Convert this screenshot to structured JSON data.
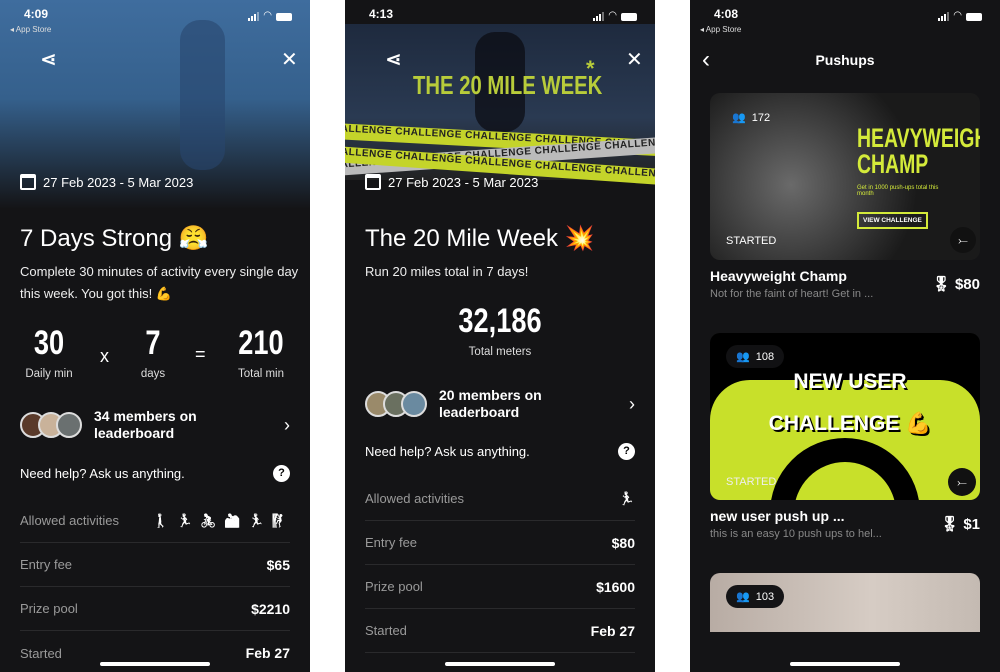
{
  "screens": [
    {
      "status_time": "4:09",
      "back_app": "◂ App Store",
      "date_range": "27 Feb 2023 - 5 Mar 2023",
      "title": "7 Days Strong 😤",
      "description": "Complete 30 minutes of activity every single day this week. You got this! 💪",
      "stats": [
        {
          "value": "30",
          "label": "Daily min"
        },
        {
          "op": "x"
        },
        {
          "value": "7",
          "label": "days"
        },
        {
          "op": "="
        },
        {
          "value": "210",
          "label": "Total min"
        }
      ],
      "leaderboard": "34 members on leaderboard",
      "help": "Need help? Ask us anything.",
      "activities_label": "Allowed activities",
      "activities_icons": [
        "walk",
        "run",
        "cycle",
        "mountain-bike",
        "treadmill",
        "hiking"
      ],
      "activities_glyphs": "🚶 🏃 🚴 🚵 🏃 🧗",
      "rows": [
        {
          "k": "Entry fee",
          "v": "$65"
        },
        {
          "k": "Prize pool",
          "v": "$2210"
        },
        {
          "k": "Started",
          "v": "Feb 27"
        }
      ]
    },
    {
      "status_time": "4:13",
      "hero_title": "THE 20 MILE WEEK",
      "hero_star": "*",
      "tape_text": "CHALLENGE  CHALLENGE  CHALLENGE  CHALLENGE  CHALLENGE  CHALLENGE",
      "date_range": "27 Feb 2023 - 5 Mar 2023",
      "title": "The 20 Mile Week 💥",
      "description": "Run 20 miles total in 7 days!",
      "total_value": "32,186",
      "total_label": "Total meters",
      "leaderboard": "20 members on leaderboard",
      "help": "Need help? Ask us anything.",
      "activities_label": "Allowed activities",
      "activities_icons": [
        "run"
      ],
      "activities_glyphs": "🏃",
      "rows": [
        {
          "k": "Entry fee",
          "v": "$80"
        },
        {
          "k": "Prize pool",
          "v": "$1600"
        },
        {
          "k": "Started",
          "v": "Feb 27"
        }
      ]
    },
    {
      "status_time": "4:08",
      "back_app": "◂ App Store",
      "header_title": "Pushups",
      "cards": [
        {
          "members": "172",
          "status": "STARTED",
          "banner_title": "HEAVYWEIGHT CHAMP",
          "banner_sub": "Get in 1000 push-ups total this month",
          "banner_button": "VIEW CHALLENGE",
          "title": "Heavyweight Champ",
          "subtitle": "Not for the faint of heart! Get in ...",
          "prize": "$80"
        },
        {
          "members": "108",
          "status": "STARTED",
          "banner_title": "NEW USER CHALLENGE 💪",
          "title": "new user push up ...",
          "subtitle": "this is an easy 10 push ups to hel...",
          "prize": "$1"
        },
        {
          "members": "103"
        }
      ]
    }
  ],
  "colors": {
    "background": "#141416",
    "accent": "#c8e02a",
    "hero_blue": "#3d6a9a"
  }
}
